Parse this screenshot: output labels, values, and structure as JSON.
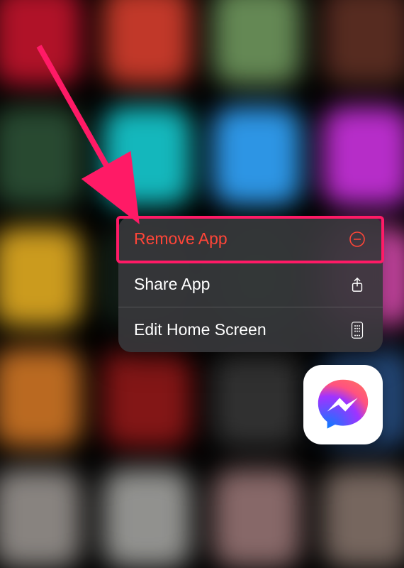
{
  "menu": {
    "items": [
      {
        "label": "Remove App",
        "icon": "minus-circle",
        "destructive": true
      },
      {
        "label": "Share App",
        "icon": "share"
      },
      {
        "label": "Edit Home Screen",
        "icon": "phone-grid"
      }
    ]
  },
  "focused_app": {
    "name": "Messenger"
  },
  "annotation": {
    "highlight_target": "Remove App"
  }
}
